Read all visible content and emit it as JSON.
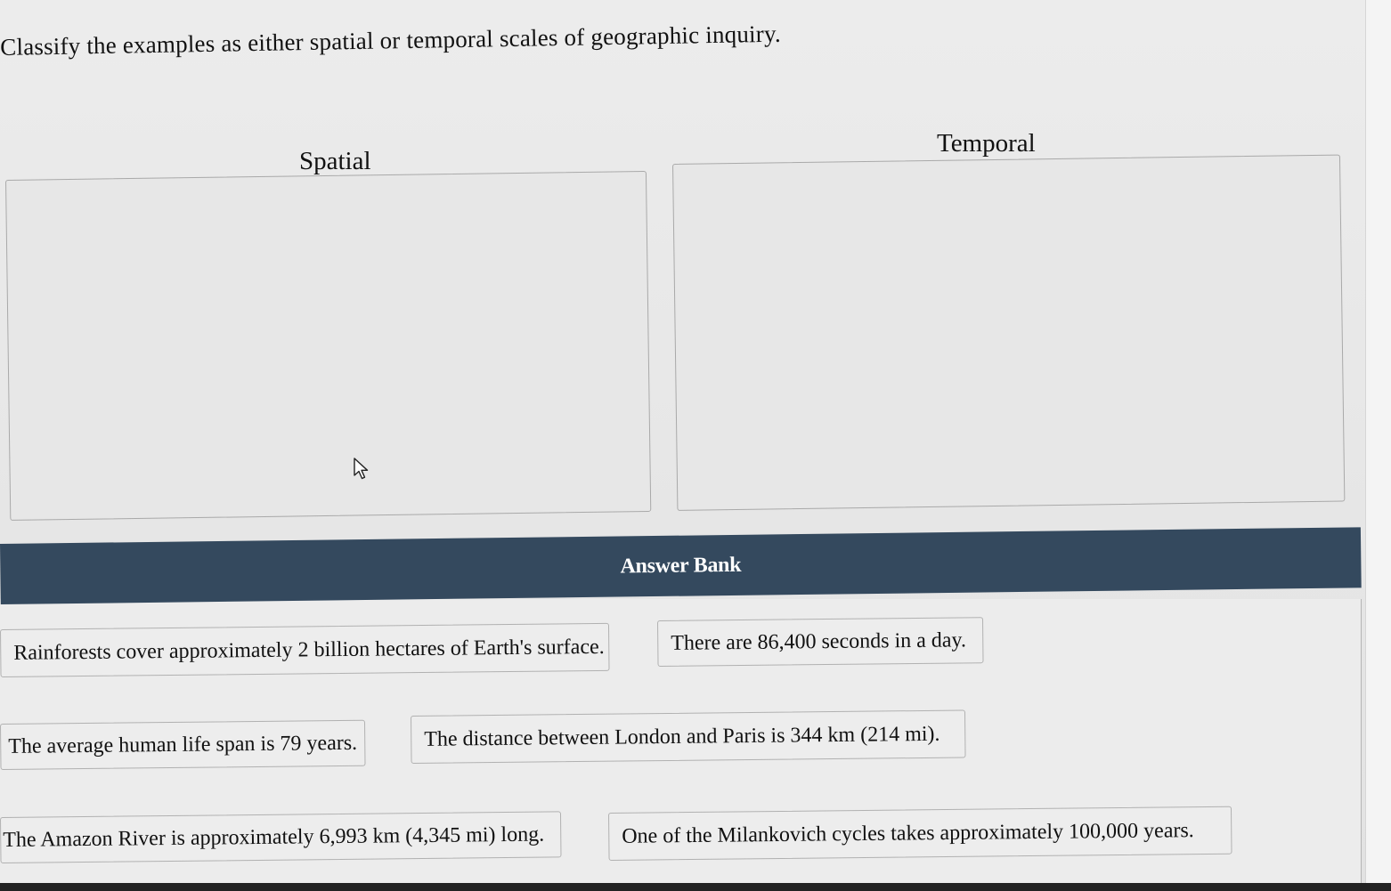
{
  "prompt": "Classify the examples as either spatial or temporal scales of geographic inquiry.",
  "columns": {
    "spatial": "Spatial",
    "temporal": "Temporal"
  },
  "answer_bank": {
    "title": "Answer Bank",
    "items": [
      "Rainforests cover approximately 2 billion hectares of Earth's surface.",
      "There are 86,400 seconds in a day.",
      "The average human life span is 79 years.",
      "The distance between London and Paris is 344 km (214 mi).",
      "The Amazon River is approximately 6,993 km (4,345 mi) long.",
      "One of the Milankovich cycles takes approximately 100,000 years."
    ]
  },
  "colors": {
    "header_bg": "#34495e",
    "page_bg": "#e9e9e9",
    "chip_border": "#b1b1b1"
  },
  "icons": {
    "cursor": "mouse-pointer-icon"
  }
}
